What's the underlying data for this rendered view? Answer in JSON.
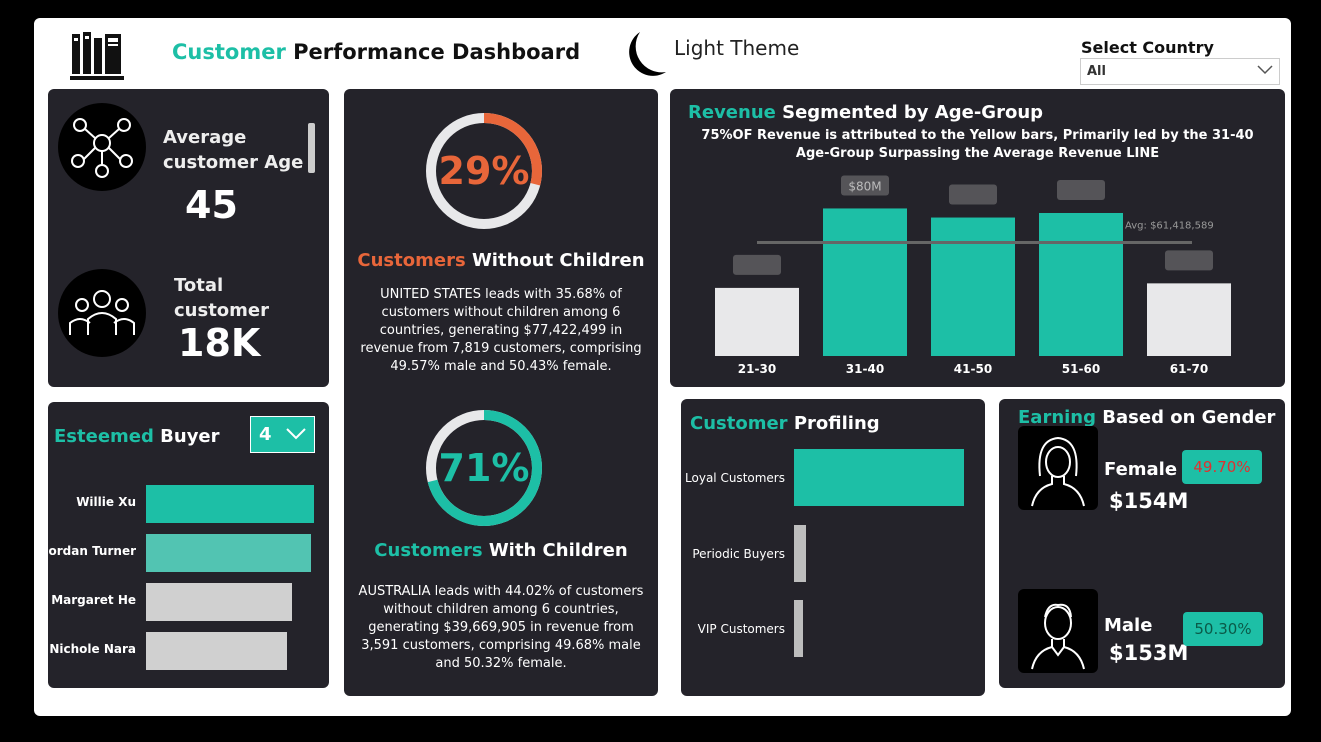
{
  "header": {
    "title_accent": "Customer",
    "title_rest": " Performance Dashboard",
    "theme_label": "Light Theme",
    "country_label": "Select Country",
    "country_value": "All"
  },
  "avg_age": {
    "label_line1": "Average",
    "label_line2": "customer Age",
    "value": "45"
  },
  "total_customer": {
    "label_line1": "Total",
    "label_line2": "customer",
    "value": "18K"
  },
  "esteemed": {
    "title_accent": "Esteemed",
    "title_rest": " Buyer",
    "select_value": "4",
    "buyers": [
      {
        "name": "Willie Xu",
        "value": 1.0,
        "color": "#1dbfa6"
      },
      {
        "name": "Jordan Turner",
        "value": 0.98,
        "color": "#52c4b2"
      },
      {
        "name": "Margaret He",
        "value": 0.87,
        "color": "#d0d0d0"
      },
      {
        "name": "Nichole Nara",
        "value": 0.84,
        "color": "#d0d0d0"
      }
    ]
  },
  "children": {
    "without": {
      "pct": "29%",
      "pct_value": 0.29,
      "title_accent": "Customers",
      "title_rest": " Without Children",
      "text": "UNITED STATES leads with 35.68% of customers without children among 6 countries, generating $77,422,499 in revenue from 7,819 customers, comprising 49.57% male and 50.43% female."
    },
    "with": {
      "pct": "71%",
      "pct_value": 0.71,
      "title_accent": "Customers",
      "title_rest": " With Children",
      "text": "AUSTRALIA leads with 44.02% of customers without children among 6 countries, generating $39,669,905 in revenue from 3,591 customers, comprising 49.68% male and 50.32% female."
    }
  },
  "revenue": {
    "title_accent": "Revenue",
    "title_rest": " Segmented by Age-Group",
    "subtitle_line1": "75%OF Revenue is attributed to the Yellow bars, Primarily led by the 31-40",
    "subtitle_line2": "Age-Group Surpassing the Average Revenue LINE",
    "avg_label": "Avg: $61,418,589"
  },
  "chart_data": {
    "type": "bar",
    "categories": [
      "21-30",
      "31-40",
      "41-50",
      "51-60",
      "61-70"
    ],
    "values": [
      30,
      65,
      61,
      63,
      32
    ],
    "data_labels": [
      "",
      "$80M",
      "",
      "",
      ""
    ],
    "colors": [
      "#e8e8ea",
      "#1dbfa6",
      "#1dbfa6",
      "#1dbfa6",
      "#e8e8ea"
    ],
    "avg_line": 50,
    "ylim": [
      0,
      100
    ]
  },
  "profiling": {
    "title_accent": "Customer",
    "title_rest": " Profiling",
    "items": [
      {
        "label": "Loyal Customers",
        "value": 1.0,
        "color": "#1dbfa6"
      },
      {
        "label": "Periodic Buyers",
        "value": 0.07,
        "color": "#bdbdbd"
      },
      {
        "label": "VIP Customers",
        "value": 0.05,
        "color": "#bdbdbd"
      }
    ]
  },
  "gender": {
    "title_accent": "Earning",
    "title_rest": " Based on Gender",
    "female": {
      "label": "Female",
      "value": "$154M",
      "pct": "49.70%",
      "pct_color": "#e03030"
    },
    "male": {
      "label": "Male",
      "value": "$153M",
      "pct": "50.30%",
      "pct_color": "#0a5a48"
    }
  },
  "colors": {
    "accent": "#1dbfa6",
    "accent_orange": "#e8663a",
    "card": "#24232a"
  }
}
